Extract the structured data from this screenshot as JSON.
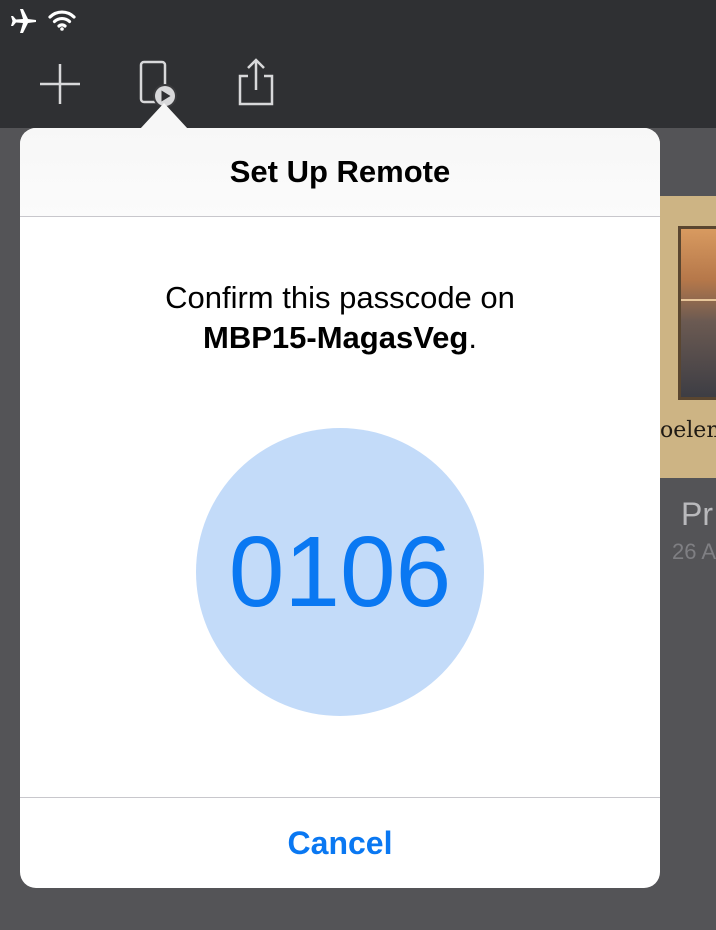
{
  "status_bar": {
    "icons": [
      "airplane-icon",
      "wifi-icon"
    ]
  },
  "toolbar": {
    "buttons": [
      "plus-icon",
      "remote-play-icon",
      "share-icon"
    ]
  },
  "background_document": {
    "caption_fragment": "oelemo",
    "title_fragment": "Pr",
    "date_fragment": "26 A"
  },
  "popover": {
    "title": "Set Up Remote",
    "message_prefix": "Confirm this passcode on",
    "device_name": "MBP15-MagasVeg",
    "message_suffix": ".",
    "passcode": "0106",
    "cancel_label": "Cancel"
  },
  "colors": {
    "accent": "#0a78f2",
    "passcode_circle": "#c3dbf9",
    "toolbar_background": "#2f3033",
    "dimmed_background": "#545457"
  }
}
